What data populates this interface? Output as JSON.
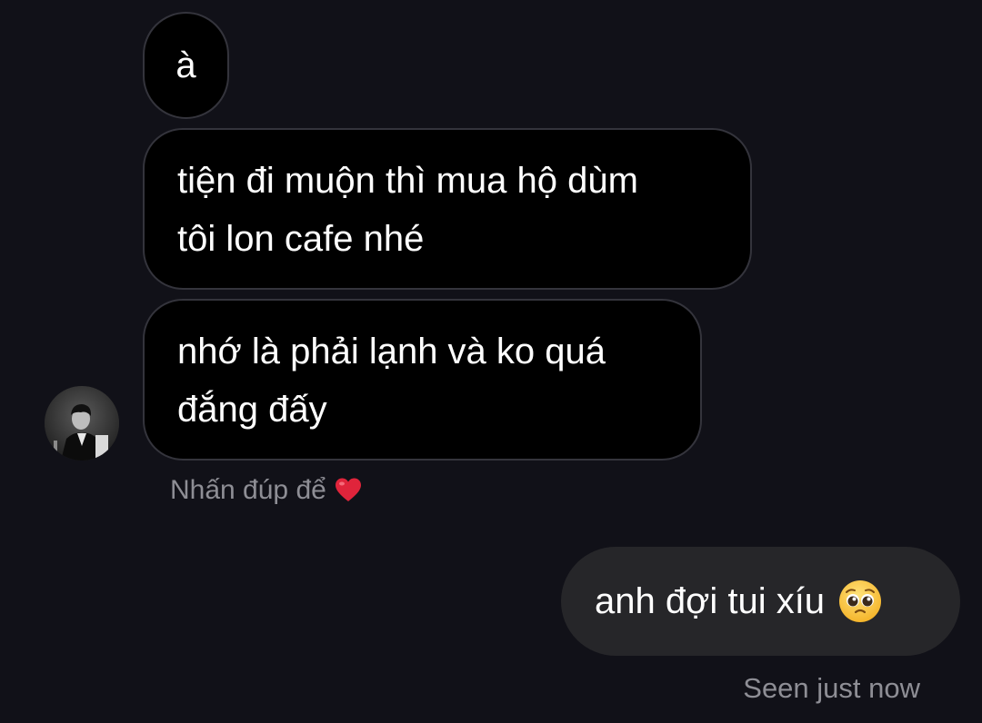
{
  "thread": {
    "incoming": [
      {
        "lines": [
          "à"
        ]
      },
      {
        "lines": [
          "tiện đi muộn thì mua hộ dùm",
          "tôi lon cafe nhé"
        ]
      },
      {
        "lines": [
          "nhớ là phải lạnh và ko quá",
          "đắng đấy"
        ]
      }
    ],
    "double_tap_hint": "Nhấn đúp để",
    "hint_icon": "heart-icon",
    "outgoing": {
      "text": "anh đợi tui xíu",
      "emoji_icon": "pleading-face-emoji"
    },
    "seen_status": "Seen just now"
  },
  "colors": {
    "background": "#111118",
    "incoming_bubble": "#000000",
    "incoming_border": "#34343c",
    "outgoing_bubble": "#262629",
    "secondary_text": "#8e8e95",
    "heart": "#e0243b"
  }
}
